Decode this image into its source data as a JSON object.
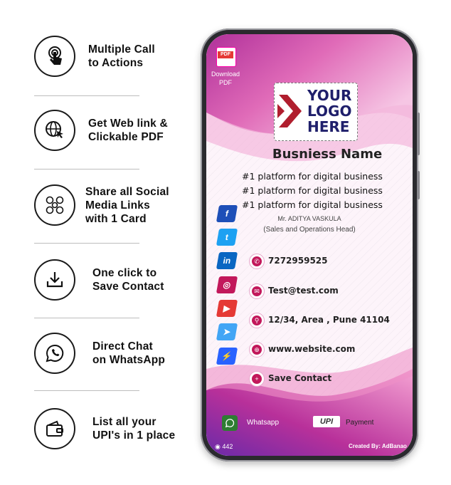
{
  "features": [
    {
      "text": "Multiple Call\nto Actions",
      "icon": "touch-hand-icon"
    },
    {
      "text": "Get Web link &\nClickable PDF",
      "icon": "web-click-icon"
    },
    {
      "text": "Share all Social\nMedia Links\nwith 1 Card",
      "icon": "social-media-icon"
    },
    {
      "text": "One click to\nSave Contact",
      "icon": "download-icon"
    },
    {
      "text": "Direct Chat\non WhatsApp",
      "icon": "whatsapp-icon"
    },
    {
      "text": "List all your\nUPI's in 1 place",
      "icon": "wallet-icon"
    }
  ],
  "card": {
    "pdf_badge": "PDF",
    "download_label": "Download\nPDF",
    "logo_text": "YOUR\nLOGO\nHERE",
    "business_name": "Busniess Name",
    "taglines": [
      "#1 platform for digital business",
      "#1 platform for digital business",
      "#1 platform for digital business"
    ],
    "person_name": "Mr. ADITYA VASKULA",
    "person_role": "(Sales and Operations Head)",
    "social": [
      {
        "icon": "facebook-icon",
        "glyph": "f",
        "color": "#1e4fb8"
      },
      {
        "icon": "twitter-icon",
        "glyph": "t",
        "color": "#1da1f2"
      },
      {
        "icon": "linkedin-icon",
        "glyph": "in",
        "color": "#0a66c2"
      },
      {
        "icon": "instagram-icon",
        "glyph": "◎",
        "color": "#c2185b"
      },
      {
        "icon": "youtube-icon",
        "glyph": "▶",
        "color": "#e53935"
      },
      {
        "icon": "telegram-icon",
        "glyph": "➤",
        "color": "#42a5f5"
      },
      {
        "icon": "messenger-icon",
        "glyph": "⚡",
        "color": "#2962ff"
      }
    ],
    "contacts": [
      {
        "icon": "phone-icon",
        "glyph": "✆",
        "text": "7272959525"
      },
      {
        "icon": "mail-icon",
        "glyph": "✉",
        "text": "Test@test.com"
      },
      {
        "icon": "location-icon",
        "glyph": "⚲",
        "text": "12/34, Area , Pune 41104"
      },
      {
        "icon": "globe-icon",
        "glyph": "⊕",
        "text": "www.website.com"
      },
      {
        "icon": "save-contact-icon",
        "glyph": "+",
        "text": "Save Contact"
      }
    ],
    "whatsapp_label": "Whatsapp",
    "upi_label": "UPI",
    "payment_label": "Payment",
    "views": "442",
    "created_by": "Created By: AdBanao"
  },
  "colors": {
    "accent": "#c2185b",
    "logo_red": "#b01e2e",
    "logo_navy": "#1f1f6b"
  }
}
